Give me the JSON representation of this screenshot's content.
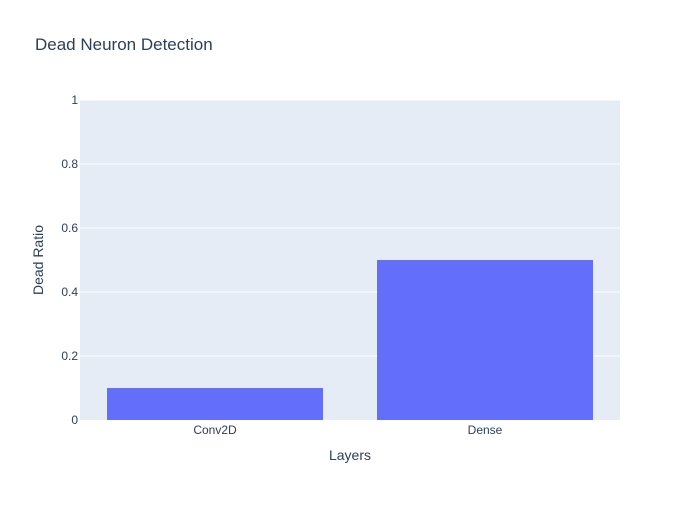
{
  "chart_data": {
    "type": "bar",
    "title": "Dead Neuron Detection",
    "xlabel": "Layers",
    "ylabel": "Dead Ratio",
    "categories": [
      "Conv2D",
      "Dense"
    ],
    "values": [
      0.1,
      0.5
    ],
    "ylim": [
      0,
      1
    ],
    "yticks": [
      0,
      0.2,
      0.4,
      0.6,
      0.8,
      1
    ],
    "ytick_labels": [
      "0",
      "0.2",
      "0.4",
      "0.6",
      "0.8",
      "1"
    ],
    "grid": true,
    "legend": "none",
    "colors": {
      "bar": "#636efa",
      "plot_background": "#e5ecf6",
      "grid": "#ffffff",
      "text": "#2a3f5f"
    }
  }
}
